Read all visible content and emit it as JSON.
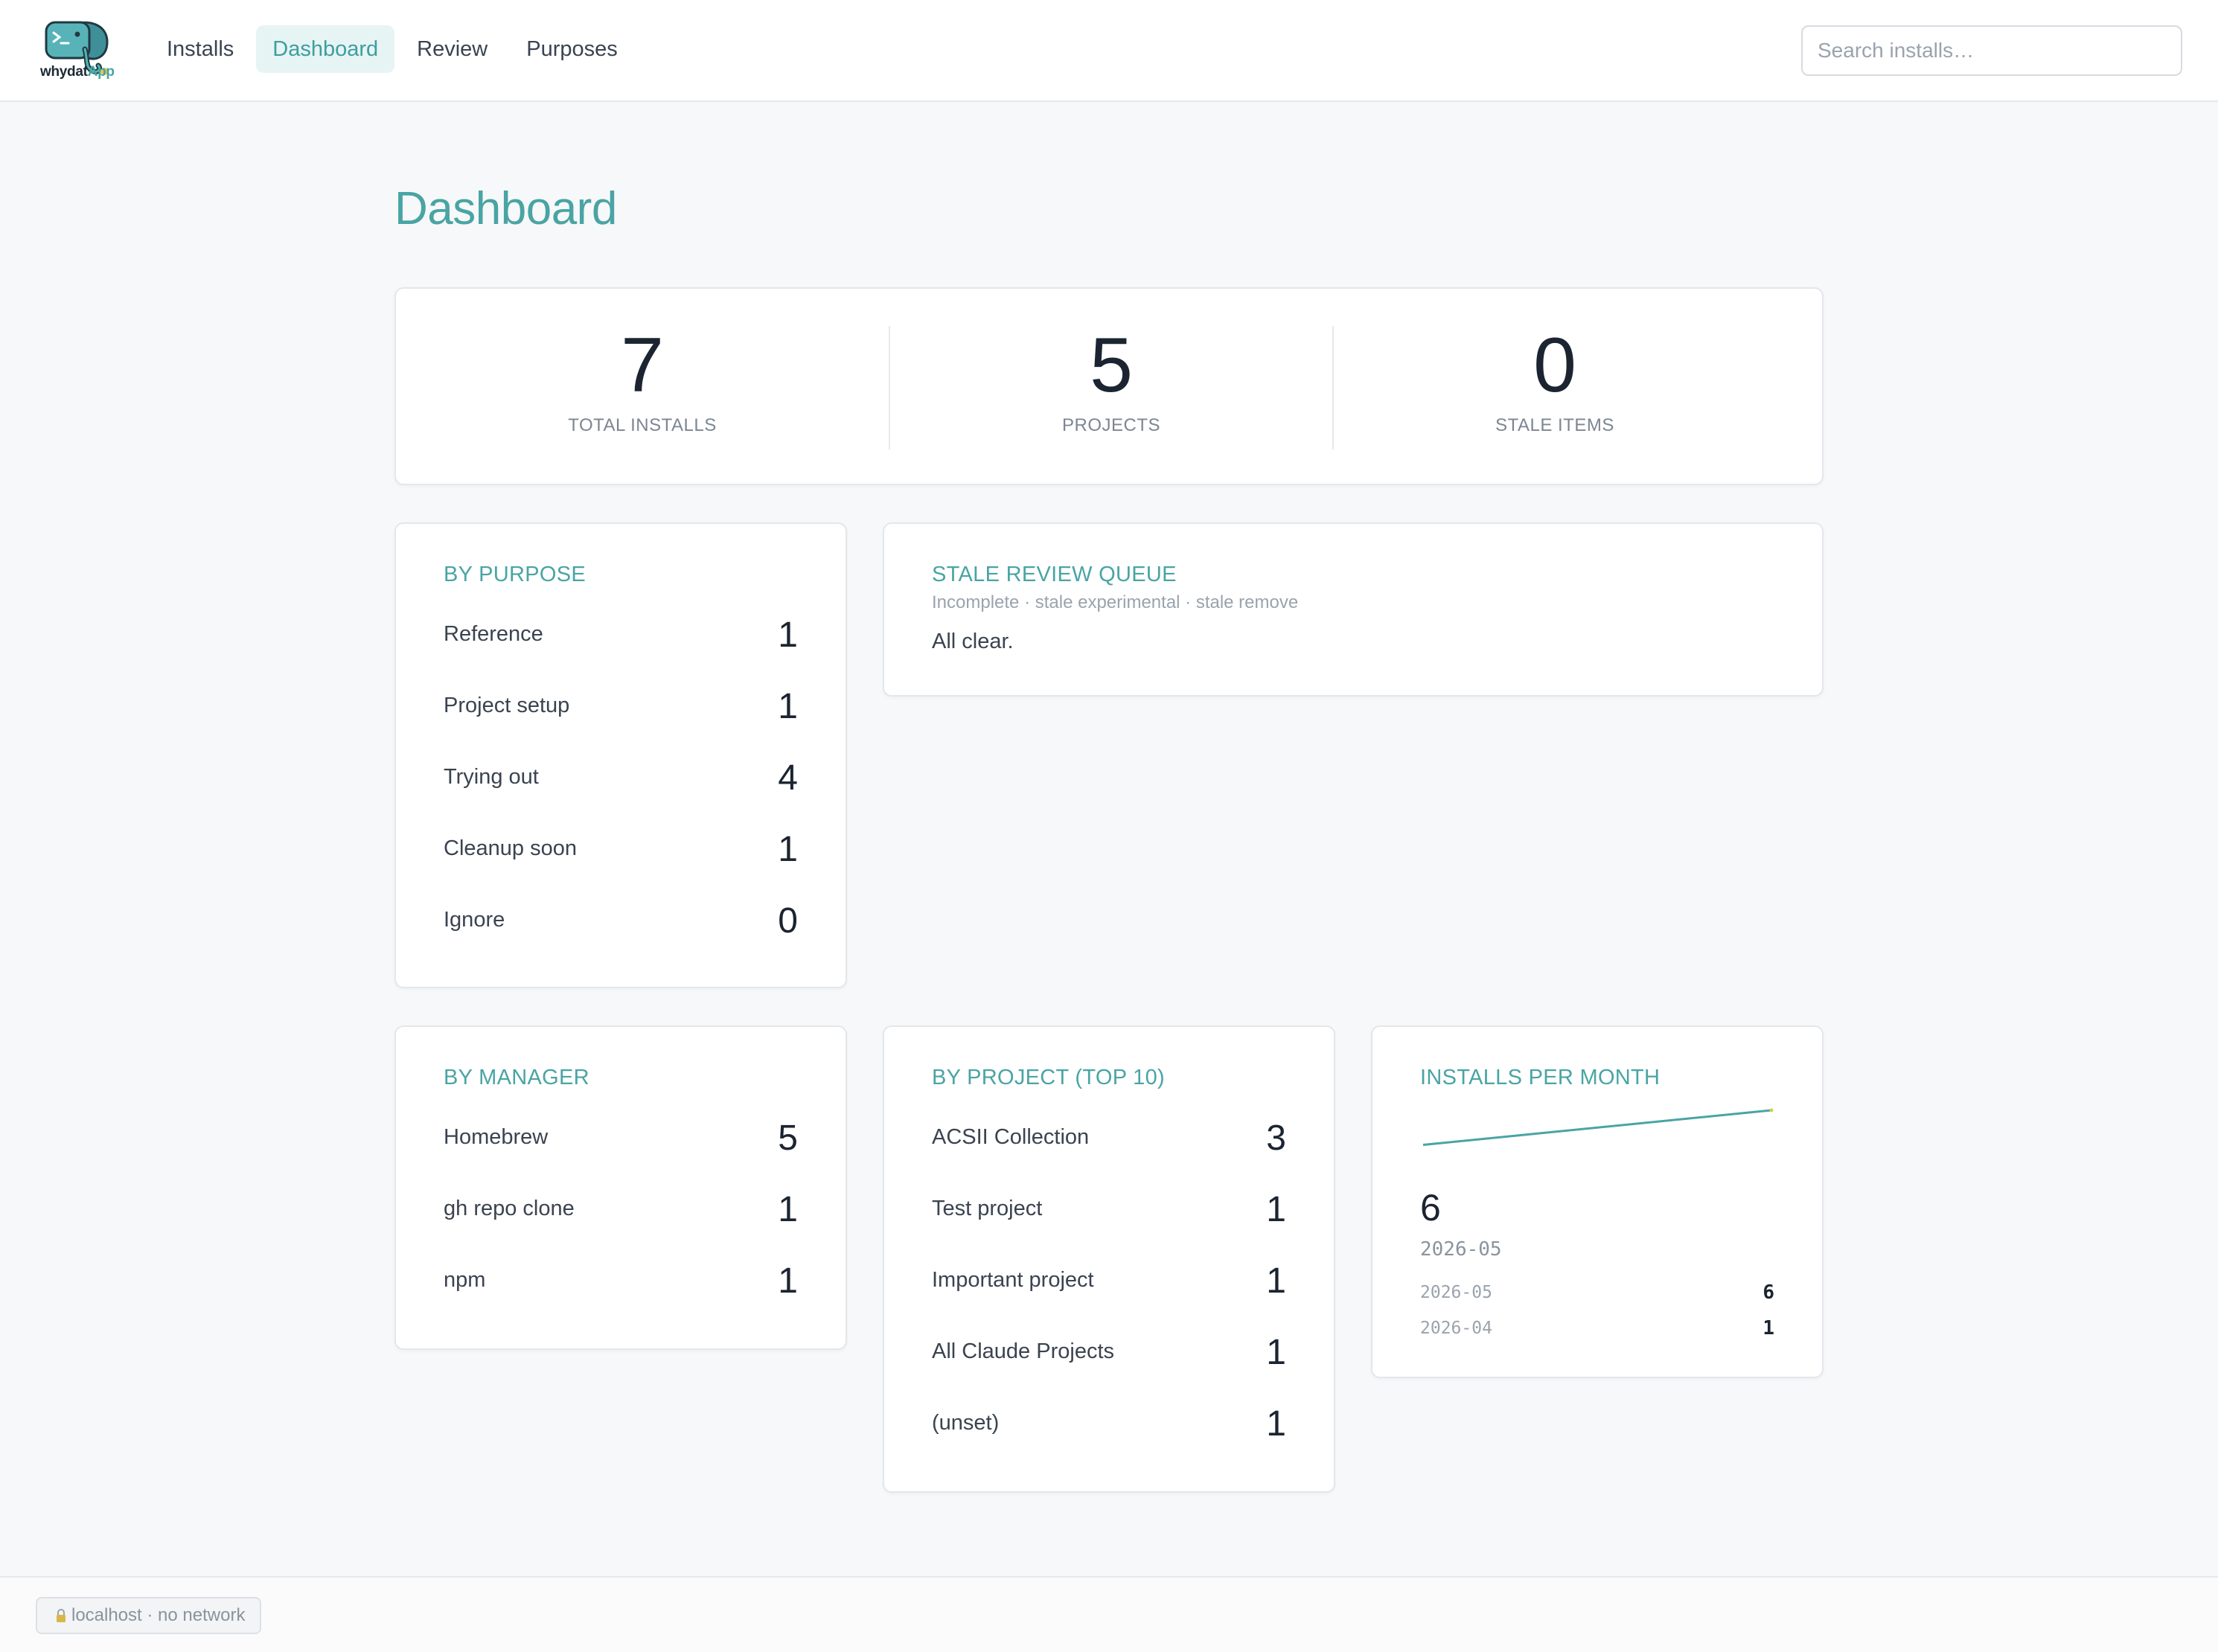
{
  "app": {
    "logo_word": "whydat",
    "logo_accent": "App"
  },
  "nav": {
    "items": [
      {
        "label": "Installs"
      },
      {
        "label": "Dashboard",
        "active": true
      },
      {
        "label": "Review"
      },
      {
        "label": "Purposes"
      }
    ]
  },
  "search": {
    "placeholder": "Search installs…",
    "value": ""
  },
  "page": {
    "title": "Dashboard"
  },
  "stats": [
    {
      "value": "7",
      "label": "TOTAL INSTALLS"
    },
    {
      "value": "5",
      "label": "PROJECTS"
    },
    {
      "value": "0",
      "label": "STALE ITEMS"
    }
  ],
  "by_purpose": {
    "title": "BY PURPOSE",
    "rows": [
      {
        "name": "Reference",
        "count": "1"
      },
      {
        "name": "Project setup",
        "count": "1"
      },
      {
        "name": "Trying out",
        "count": "4"
      },
      {
        "name": "Cleanup soon",
        "count": "1"
      },
      {
        "name": "Ignore",
        "count": "0"
      }
    ]
  },
  "stale_queue": {
    "title": "STALE REVIEW QUEUE",
    "subtitle": "Incomplete · stale experimental · stale remove",
    "message": "All clear."
  },
  "by_manager": {
    "title": "BY MANAGER",
    "rows": [
      {
        "name": "Homebrew",
        "count": "5"
      },
      {
        "name": "gh repo clone",
        "count": "1"
      },
      {
        "name": "npm",
        "count": "1"
      }
    ]
  },
  "by_project": {
    "title": "BY PROJECT (TOP 10)",
    "rows": [
      {
        "name": "ACSII Collection",
        "count": "3"
      },
      {
        "name": "Test project",
        "count": "1"
      },
      {
        "name": "Important project",
        "count": "1"
      },
      {
        "name": "All Claude Projects",
        "count": "1"
      },
      {
        "name": "(unset)",
        "count": "1"
      }
    ]
  },
  "installs_per_month": {
    "title": "INSTALLS PER MONTH",
    "latest_value": "6",
    "latest_month": "2026-05",
    "rows": [
      {
        "month": "2026-05",
        "count": "6"
      },
      {
        "month": "2026-04",
        "count": "1"
      }
    ],
    "sparkline_color": "#4aa4a4",
    "endpoint_color": "#c9d64a"
  },
  "footer": {
    "status": "localhost · no network"
  },
  "colors": {
    "accent": "#4aa4a4",
    "nav_active_bg": "#e7f4f4"
  }
}
